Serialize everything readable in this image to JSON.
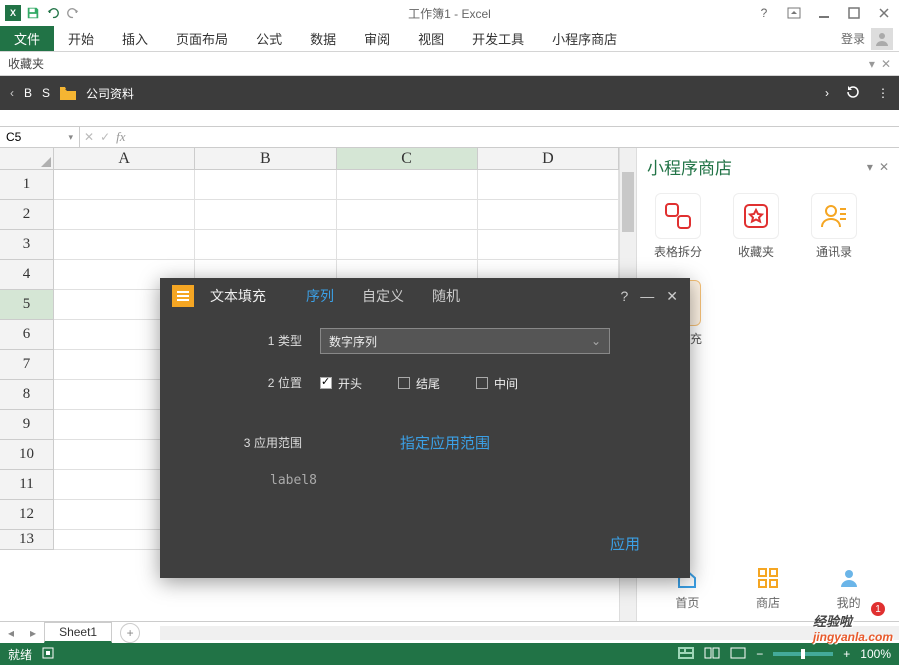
{
  "titlebar": {
    "title": "工作簿1 - Excel"
  },
  "ribbon": {
    "tabs": [
      "文件",
      "开始",
      "插入",
      "页面布局",
      "公式",
      "数据",
      "审阅",
      "视图",
      "开发工具",
      "小程序商店"
    ],
    "login": "登录"
  },
  "favbar": {
    "label": "收藏夹"
  },
  "darkbar": {
    "items": [
      "B",
      "S"
    ],
    "folder": "公司资料"
  },
  "namebox": {
    "cell": "C5"
  },
  "columns": [
    "A",
    "B",
    "C",
    "D"
  ],
  "rows": [
    "1",
    "2",
    "3",
    "4",
    "5",
    "6",
    "7",
    "8",
    "9",
    "10",
    "11",
    "12",
    "13"
  ],
  "selected": {
    "col": 2,
    "row": 4
  },
  "pane": {
    "title": "小程序商店",
    "apps": [
      {
        "label": "表格拆分",
        "color": "#e03030"
      },
      {
        "label": "收藏夹",
        "color": "#e03030"
      },
      {
        "label": "通讯录",
        "color": "#f5a623"
      }
    ],
    "apps2": [
      {
        "label": "文本填充",
        "color": "#f5a623",
        "selected": true
      }
    ],
    "nav": [
      {
        "label": "首页"
      },
      {
        "label": "商店"
      },
      {
        "label": "我的"
      }
    ]
  },
  "dialog": {
    "title": "文本填充",
    "tabs": [
      "序列",
      "自定义",
      "随机"
    ],
    "active_tab": 0,
    "rows": {
      "type": {
        "num": "1",
        "label": "类型",
        "value": "数字序列"
      },
      "pos": {
        "num": "2",
        "label": "位置",
        "options": [
          "开头",
          "结尾",
          "中间"
        ],
        "checked": 0
      },
      "range": {
        "num": "3",
        "label": "应用范围",
        "link": "指定应用范围"
      }
    },
    "label8": "label8",
    "apply": "应用"
  },
  "sheettab": {
    "name": "Sheet1"
  },
  "statusbar": {
    "ready": "就绪",
    "zoom": "100%"
  },
  "watermark": {
    "top": "经验啦",
    "url": "jingyanla.com"
  },
  "badge": "1"
}
